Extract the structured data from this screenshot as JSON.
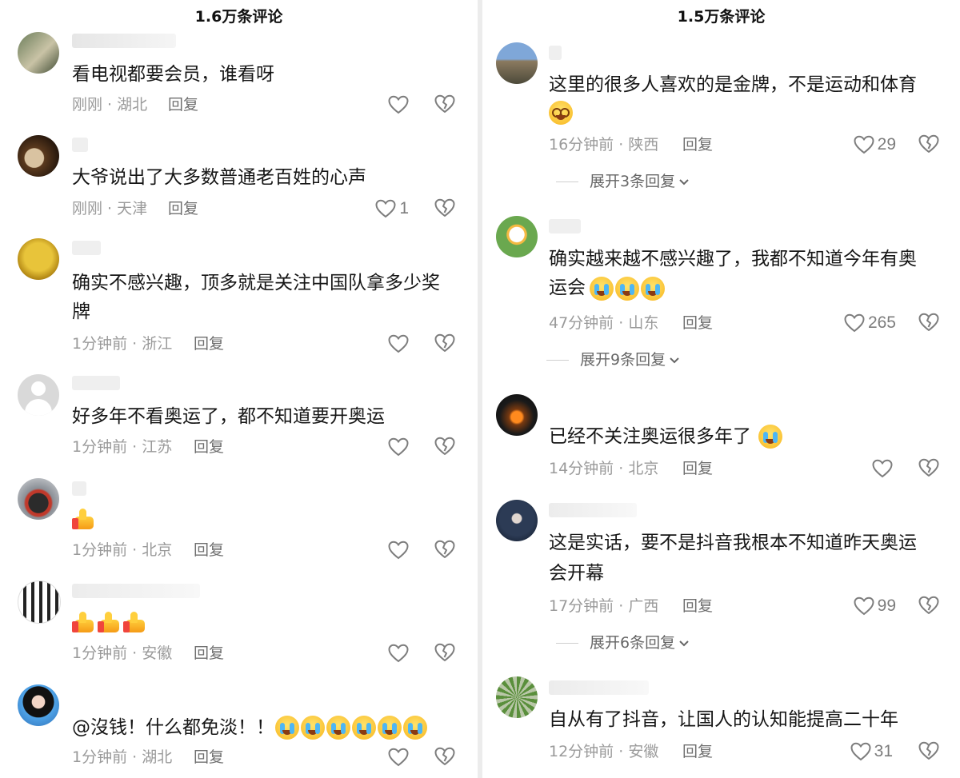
{
  "left_panel": {
    "title": "1.6万条评论",
    "comments": [
      {
        "username": "",
        "text": "看电视都要会员，谁看呀",
        "time": "刚刚",
        "location": "湖北",
        "reply": "回复",
        "likes": ""
      },
      {
        "username": "",
        "text": "大爷说出了大多数普通老百姓的心声",
        "time": "刚刚",
        "location": "天津",
        "reply": "回复",
        "likes": "1"
      },
      {
        "username": "",
        "text_lines": [
          "确实不感兴趣，顶多就是关注中国队拿多少奖",
          "牌"
        ],
        "time": "1分钟前",
        "location": "浙江",
        "reply": "回复",
        "likes": ""
      },
      {
        "username": "",
        "text": "好多年不看奥运了，都不知道要开奥运",
        "time": "1分钟前",
        "location": "江苏",
        "reply": "回复",
        "likes": ""
      },
      {
        "username": "",
        "emoji": [
          "thumbs-up"
        ],
        "time": "1分钟前",
        "location": "北京",
        "reply": "回复",
        "likes": ""
      },
      {
        "username": "",
        "emoji": [
          "thumbs-up",
          "thumbs-up",
          "thumbs-up"
        ],
        "time": "1分钟前",
        "location": "安徽",
        "reply": "回复",
        "likes": ""
      },
      {
        "username": "",
        "text": "@沒钱！什么都免淡！！",
        "emoji": [
          "crying-face",
          "crying-face",
          "crying-face",
          "crying-face",
          "crying-face",
          "crying-face"
        ],
        "time": "1分钟前",
        "location": "湖北",
        "reply": "回复",
        "likes": ""
      }
    ]
  },
  "right_panel": {
    "title": "1.5万条评论",
    "comments": [
      {
        "username": "",
        "text": "这里的很多人喜欢的是金牌，不是运动和体育",
        "emoji": [
          "dizzy-face"
        ],
        "time": "16分钟前",
        "location": "陕西",
        "reply": "回复",
        "likes": "29",
        "expand": "展开3条回复"
      },
      {
        "username": "",
        "text_lines": [
          "确实越来越不感兴趣了，我都不知道今年有奥",
          "运会"
        ],
        "emoji": [
          "rofl-face",
          "rofl-face",
          "rofl-face"
        ],
        "time": "47分钟前",
        "location": "山东",
        "reply": "回复",
        "likes": "265",
        "expand": "展开9条回复"
      },
      {
        "username": "",
        "text": "已经不关注奥运很多年了",
        "emoji": [
          "rofl-face"
        ],
        "time": "14分钟前",
        "location": "北京",
        "reply": "回复",
        "likes": ""
      },
      {
        "username": "",
        "text_lines": [
          "这是实话，要不是抖音我根本不知道昨天奥运",
          "会开幕"
        ],
        "time": "17分钟前",
        "location": "广西",
        "reply": "回复",
        "likes": "99",
        "expand": "展开6条回复"
      },
      {
        "username": "",
        "text": "自从有了抖音，让国人的认知能提高二十年",
        "time": "12分钟前",
        "location": "安徽",
        "reply": "回复",
        "likes": "31"
      }
    ]
  },
  "separator": " · ",
  "icons": {
    "like": "heart-outline-icon",
    "dislike": "broken-heart-icon",
    "expand": "chevron-down-icon"
  },
  "colors": {
    "text": "#161616",
    "meta": "#9a9a9a",
    "icon": "#7d7d7d"
  }
}
